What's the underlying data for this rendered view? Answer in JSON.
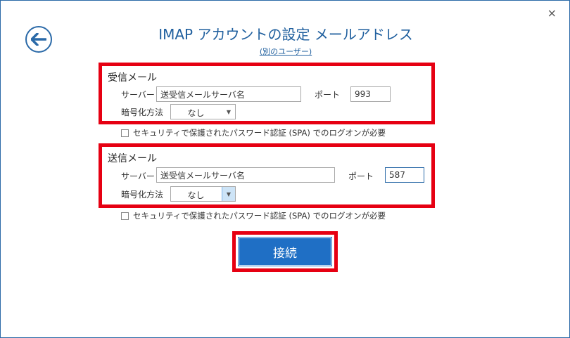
{
  "window": {
    "close_glyph": "×"
  },
  "header": {
    "title": "IMAP アカウントの設定 メールアドレス",
    "other_user_link": "(別のユーザー)"
  },
  "incoming": {
    "section_label": "受信メール",
    "server_label": "サーバー",
    "server_value": "送受信メールサーバ名",
    "port_label": "ポート",
    "port_value": "993",
    "encryption_label": "暗号化方法",
    "encryption_value": "なし",
    "spa_label": "セキュリティで保護されたパスワード認証 (SPA) でのログオンが必要"
  },
  "outgoing": {
    "section_label": "送信メール",
    "server_label": "サーバー",
    "server_value": "送受信メールサーバ名",
    "port_label": "ポート",
    "port_value": "587",
    "encryption_label": "暗号化方法",
    "encryption_value": "なし",
    "spa_label": "セキュリティで保護されたパスワード認証 (SPA) でのログオンが必要"
  },
  "connect_button": {
    "label": "接続"
  },
  "colors": {
    "accent": "#1f6fc5",
    "highlight": "#e60012",
    "title": "#1f5f9e"
  },
  "icons": {
    "back": "arrow-left-icon",
    "dropdown": "chevron-down-icon",
    "close": "close-icon"
  }
}
